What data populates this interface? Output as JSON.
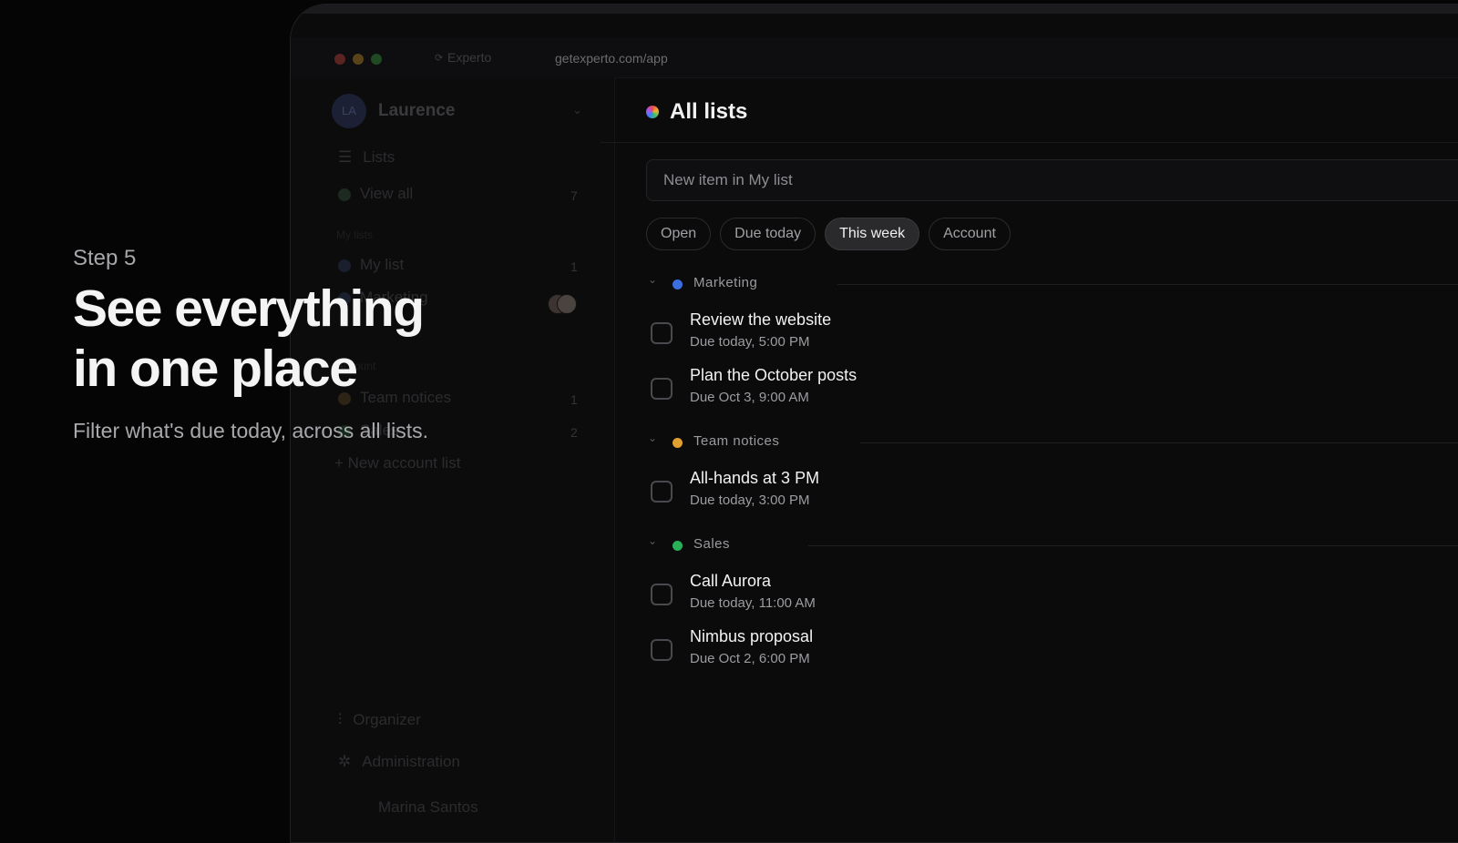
{
  "browser": {
    "tab_title": "Experto",
    "url": "getexperto.com/app",
    "traffic_lights": [
      "#5a2422",
      "#5a4318",
      "#1f4a22"
    ]
  },
  "sidebar": {
    "avatar_initials": "LA",
    "user_name": "Laurence",
    "nav_lists": "Lists",
    "view_all": {
      "label": "View all",
      "count": "7"
    },
    "section_my_lists": "My lists",
    "my_list": {
      "label": "My list",
      "count": "1"
    },
    "marketing": {
      "label": "Marketing"
    },
    "section_account": "Account",
    "team_notices": {
      "label": "Team notices",
      "count": "1"
    },
    "sales": {
      "label": "Sales",
      "count": "2"
    },
    "new_account_list": "+ New account list",
    "organizer": "Organizer",
    "administration": "Administration",
    "footer_user": "Marina Santos"
  },
  "main": {
    "title": "All lists",
    "new_item_placeholder": "New item in My list",
    "filters": [
      "Open",
      "Due today",
      "This week",
      "Account"
    ],
    "active_filter": "This week",
    "groups": [
      {
        "name": "Marketing",
        "color": "#3b6fe0",
        "tasks": [
          {
            "title": "Review the website",
            "due": "Due today, 5:00 PM"
          },
          {
            "title": "Plan the October posts",
            "due": "Due Oct 3, 9:00 AM"
          }
        ]
      },
      {
        "name": "Team notices",
        "color": "#e0a030",
        "tasks": [
          {
            "title": "All-hands at 3 PM",
            "due": "Due today, 3:00 PM"
          }
        ]
      },
      {
        "name": "Sales",
        "color": "#2bb05a",
        "tasks": [
          {
            "title": "Call Aurora",
            "due": "Due today, 11:00 AM"
          },
          {
            "title": "Nimbus proposal",
            "due": "Due Oct 2, 6:00 PM"
          }
        ]
      }
    ]
  },
  "promo": {
    "step": "Step 5",
    "headline_line1": "See everything",
    "headline_line2": "in one place",
    "subtitle": "Filter what's due today, across all lists."
  }
}
